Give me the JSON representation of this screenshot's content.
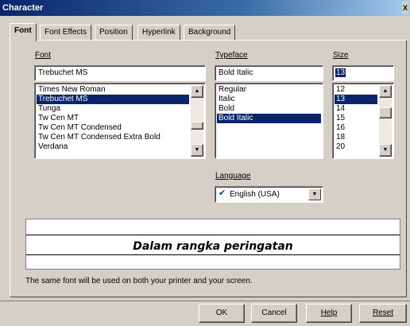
{
  "window": {
    "title": "Character",
    "close_glyph": "X"
  },
  "tabs": [
    {
      "label": "Font",
      "active": true
    },
    {
      "label": "Font Effects",
      "active": false
    },
    {
      "label": "Position",
      "active": false
    },
    {
      "label": "Hyperlink",
      "active": false
    },
    {
      "label": "Background",
      "active": false
    }
  ],
  "font": {
    "label": "Font",
    "value": "Trebuchet MS",
    "options": [
      "Times New Roman",
      "Trebuchet MS",
      "Tunga",
      "Tw Cen MT",
      "Tw Cen MT Condensed",
      "Tw Cen MT Condensed Extra Bold",
      "Verdana"
    ],
    "selected_index": 1
  },
  "typeface": {
    "label": "Typeface",
    "value": "Bold Italic",
    "options": [
      "Regular",
      "Italic",
      "Bold",
      "Bold Italic"
    ],
    "selected_index": 3
  },
  "size": {
    "label": "Size",
    "value": "13",
    "options": [
      "12",
      "13",
      "14",
      "15",
      "16",
      "18",
      "20"
    ],
    "selected_index": 1
  },
  "language": {
    "label": "Language",
    "value": "English (USA)",
    "icon": "spellcheck-icon"
  },
  "preview": {
    "text": "Dalam rangka peringatan"
  },
  "note": "The same font will be used on both your printer and your screen.",
  "buttons": {
    "ok": "OK",
    "cancel": "Cancel",
    "help": "Help",
    "reset": "Reset"
  },
  "colors": {
    "selection": "#0a246a",
    "titlebar": "#0a246a",
    "face": "#d4d0c8"
  }
}
